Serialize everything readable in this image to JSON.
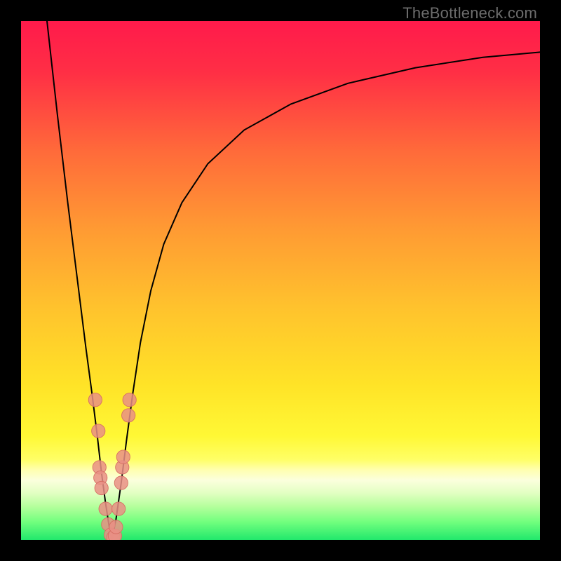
{
  "watermark": "TheBottleneck.com",
  "colors": {
    "frame": "#000000",
    "curve": "#000000",
    "marker_fill": "#e98f85",
    "marker_stroke": "#d66f63",
    "gradient_stops": [
      {
        "offset": 0.0,
        "color": "#ff1a4b"
      },
      {
        "offset": 0.1,
        "color": "#ff2f45"
      },
      {
        "offset": 0.25,
        "color": "#ff6a3a"
      },
      {
        "offset": 0.4,
        "color": "#ff9a33"
      },
      {
        "offset": 0.55,
        "color": "#ffc22d"
      },
      {
        "offset": 0.7,
        "color": "#ffe327"
      },
      {
        "offset": 0.8,
        "color": "#fff835"
      },
      {
        "offset": 0.845,
        "color": "#ffff66"
      },
      {
        "offset": 0.865,
        "color": "#ffffb0"
      },
      {
        "offset": 0.885,
        "color": "#fbffdd"
      },
      {
        "offset": 0.908,
        "color": "#e4ffc4"
      },
      {
        "offset": 0.935,
        "color": "#b6ff9d"
      },
      {
        "offset": 0.965,
        "color": "#72ff7e"
      },
      {
        "offset": 1.0,
        "color": "#21e86c"
      }
    ]
  },
  "chart_data": {
    "type": "line",
    "title": "",
    "xlabel": "",
    "ylabel": "",
    "xlim": [
      0,
      100
    ],
    "ylim": [
      0,
      100
    ],
    "notch_x": 17.5,
    "left_branch": [
      {
        "x": 5.0,
        "y": 100.0
      },
      {
        "x": 7.0,
        "y": 82.0
      },
      {
        "x": 9.0,
        "y": 65.0
      },
      {
        "x": 11.0,
        "y": 49.0
      },
      {
        "x": 12.5,
        "y": 37.0
      },
      {
        "x": 13.7,
        "y": 28.0
      },
      {
        "x": 14.7,
        "y": 20.0
      },
      {
        "x": 15.5,
        "y": 13.0
      },
      {
        "x": 16.3,
        "y": 7.0
      },
      {
        "x": 17.0,
        "y": 2.5
      },
      {
        "x": 17.5,
        "y": 0.0
      }
    ],
    "right_branch": [
      {
        "x": 17.5,
        "y": 0.0
      },
      {
        "x": 18.3,
        "y": 4.0
      },
      {
        "x": 19.3,
        "y": 11.0
      },
      {
        "x": 20.3,
        "y": 19.0
      },
      {
        "x": 21.5,
        "y": 28.0
      },
      {
        "x": 23.0,
        "y": 38.0
      },
      {
        "x": 25.0,
        "y": 48.0
      },
      {
        "x": 27.5,
        "y": 57.0
      },
      {
        "x": 31.0,
        "y": 65.0
      },
      {
        "x": 36.0,
        "y": 72.5
      },
      {
        "x": 43.0,
        "y": 79.0
      },
      {
        "x": 52.0,
        "y": 84.0
      },
      {
        "x": 63.0,
        "y": 88.0
      },
      {
        "x": 76.0,
        "y": 91.0
      },
      {
        "x": 89.0,
        "y": 93.0
      },
      {
        "x": 100.0,
        "y": 94.0
      }
    ],
    "series": [
      {
        "name": "markers",
        "points": [
          {
            "x": 14.3,
            "y": 27.0
          },
          {
            "x": 14.9,
            "y": 21.0
          },
          {
            "x": 15.1,
            "y": 14.0
          },
          {
            "x": 15.3,
            "y": 12.0
          },
          {
            "x": 15.5,
            "y": 10.0
          },
          {
            "x": 16.3,
            "y": 6.0
          },
          {
            "x": 16.8,
            "y": 3.0
          },
          {
            "x": 17.3,
            "y": 1.0
          },
          {
            "x": 17.8,
            "y": 0.5
          },
          {
            "x": 18.1,
            "y": 0.8
          },
          {
            "x": 18.3,
            "y": 2.5
          },
          {
            "x": 18.8,
            "y": 6.0
          },
          {
            "x": 19.3,
            "y": 11.0
          },
          {
            "x": 19.5,
            "y": 14.0
          },
          {
            "x": 19.7,
            "y": 16.0
          },
          {
            "x": 20.7,
            "y": 24.0
          },
          {
            "x": 20.9,
            "y": 27.0
          }
        ]
      }
    ]
  }
}
